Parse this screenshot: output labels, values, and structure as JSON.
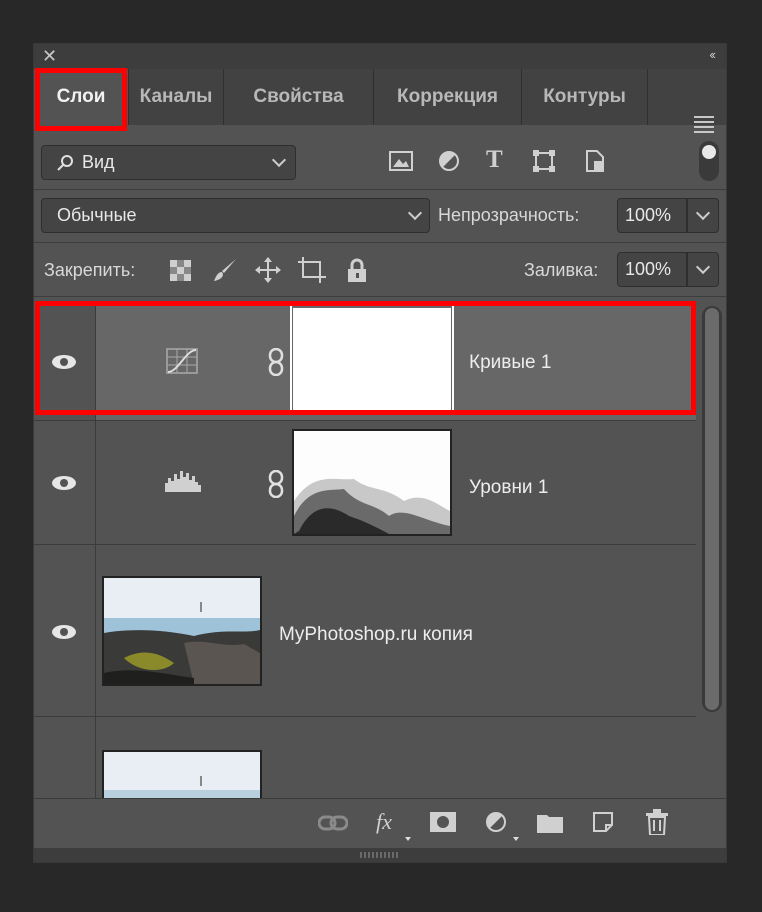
{
  "tabs": [
    {
      "label": "Слои",
      "active": true
    },
    {
      "label": "Каналы",
      "active": false
    },
    {
      "label": "Свойства",
      "active": false
    },
    {
      "label": "Коррекция",
      "active": false
    },
    {
      "label": "Контуры",
      "active": false
    }
  ],
  "filter": {
    "label": "Вид"
  },
  "blend": {
    "mode": "Обычные",
    "opacity_label": "Непрозрачность:",
    "opacity_value": "100%"
  },
  "lock": {
    "label": "Закрепить:",
    "fill_label": "Заливка:",
    "fill_value": "100%"
  },
  "layers": [
    {
      "name": "Кривые 1",
      "type": "curves-adjustment",
      "selected": true
    },
    {
      "name": "Уровни 1",
      "type": "levels-adjustment",
      "selected": false
    },
    {
      "name": "MyPhotoshop.ru копия",
      "type": "image",
      "selected": false
    },
    {
      "name": "",
      "type": "image",
      "selected": false
    }
  ],
  "bottom_icons": [
    "link-icon",
    "fx-icon",
    "mask-icon",
    "adjustment-icon",
    "folder-icon",
    "new-layer-icon",
    "trash-icon"
  ],
  "colors": {
    "highlight": "#ff0000",
    "panel": "#535353",
    "selected_layer": "#676767"
  }
}
